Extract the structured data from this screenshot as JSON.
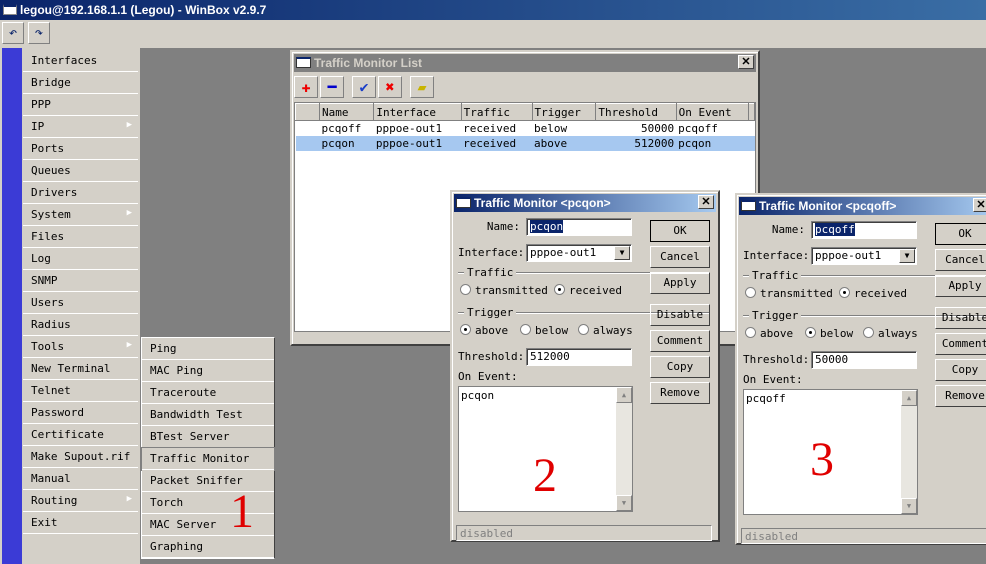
{
  "app": {
    "title": "legou@192.168.1.1 (Legou) - WinBox v2.9.7",
    "undo_icon": "undo-icon",
    "redo_icon": "redo-icon"
  },
  "menu": [
    "Interfaces",
    "Bridge",
    "PPP",
    "IP",
    "Ports",
    "Queues",
    "Drivers",
    "System",
    "Files",
    "Log",
    "SNMP",
    "Users",
    "Radius",
    "Tools",
    "New Terminal",
    "Telnet",
    "Password",
    "Certificate",
    "Make Supout.rif",
    "Manual",
    "Routing",
    "Exit"
  ],
  "submenu": [
    "Ping",
    "MAC Ping",
    "Traceroute",
    "Bandwidth Test",
    "BTest Server",
    "Traffic Monitor",
    "Packet Sniffer",
    "Torch",
    "MAC Server",
    "Graphing"
  ],
  "list": {
    "title": "Traffic Monitor List",
    "columns": [
      "Name",
      "Interface",
      "Traffic",
      "Trigger",
      "Threshold",
      "On Event"
    ],
    "rows": [
      [
        "pcqoff",
        "pppoe-out1",
        "received",
        "below",
        "50000",
        "pcqoff"
      ],
      [
        "pcqon",
        "pppoe-out1",
        "received",
        "above",
        "512000",
        "pcqon"
      ]
    ],
    "selected_row": 1
  },
  "dlg1": {
    "title": "Traffic Monitor <pcqon>",
    "name": "pcqon",
    "interface": "pppoe-out1",
    "threshold": "512000",
    "on_event": "pcqon",
    "traffic": "received",
    "trigger": "above",
    "status": "disabled"
  },
  "dlg2": {
    "title": "Traffic Monitor <pcqoff>",
    "name": "pcqoff",
    "interface": "pppoe-out1",
    "threshold": "50000",
    "on_event": "pcqoff",
    "traffic": "received",
    "trigger": "below",
    "status": "disabled"
  },
  "labels": {
    "name": "Name:",
    "interface": "Interface:",
    "traffic": "Traffic",
    "transmitted": "transmitted",
    "received": "received",
    "trigger": "Trigger",
    "above": "above",
    "below": "below",
    "always": "always",
    "threshold": "Threshold:",
    "on_event": "On Event:",
    "ok": "OK",
    "cancel": "Cancel",
    "apply": "Apply",
    "disable": "Disable",
    "comment": "Comment",
    "copy": "Copy",
    "remove": "Remove"
  },
  "annotations": [
    "1",
    "2",
    "3"
  ],
  "colors": {
    "title_active": "#0a246a",
    "selection": "#a6c8f0",
    "sidebar_strip": "#3b3bd6",
    "annotation": "#e00000"
  }
}
